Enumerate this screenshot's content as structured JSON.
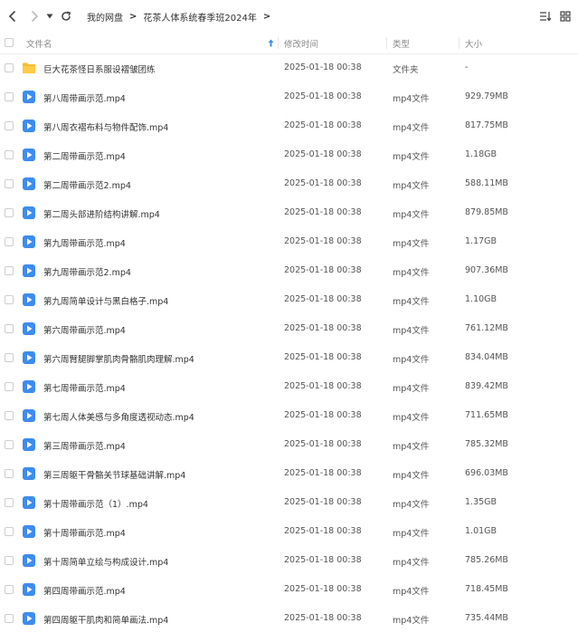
{
  "breadcrumb": [
    "我的网盘",
    "花茶人体系统春季班2024年"
  ],
  "columns": {
    "name": "文件名",
    "time": "修改时间",
    "type": "类型",
    "size": "大小"
  },
  "colors": {
    "folder": "#f5bd2f",
    "video": "#3d8cf0"
  },
  "files": [
    {
      "icon": "folder-icon",
      "name": "巨大花茶怪日系服设褶皱团练",
      "time": "2025-01-18 00:38",
      "type": "文件夹",
      "size": "-"
    },
    {
      "icon": "video-file-icon",
      "name": "第八周带画示范.mp4",
      "time": "2025-01-18 00:38",
      "type": "mp4文件",
      "size": "929.79MB"
    },
    {
      "icon": "video-file-icon",
      "name": "第八周衣褶布料与物件配饰.mp4",
      "time": "2025-01-18 00:38",
      "type": "mp4文件",
      "size": "817.75MB"
    },
    {
      "icon": "video-file-icon",
      "name": "第二周带画示范.mp4",
      "time": "2025-01-18 00:38",
      "type": "mp4文件",
      "size": "1.18GB"
    },
    {
      "icon": "video-file-icon",
      "name": "第二周带画示范2.mp4",
      "time": "2025-01-18 00:38",
      "type": "mp4文件",
      "size": "588.11MB"
    },
    {
      "icon": "video-file-icon",
      "name": "第二周头部进阶结构讲解.mp4",
      "time": "2025-01-18 00:38",
      "type": "mp4文件",
      "size": "879.85MB"
    },
    {
      "icon": "video-file-icon",
      "name": "第九周带画示范.mp4",
      "time": "2025-01-18 00:38",
      "type": "mp4文件",
      "size": "1.17GB"
    },
    {
      "icon": "video-file-icon",
      "name": "第九周带画示范2.mp4",
      "time": "2025-01-18 00:38",
      "type": "mp4文件",
      "size": "907.36MB"
    },
    {
      "icon": "video-file-icon",
      "name": "第九周简单设计与黑白格子.mp4",
      "time": "2025-01-18 00:38",
      "type": "mp4文件",
      "size": "1.10GB"
    },
    {
      "icon": "video-file-icon",
      "name": "第六周带画示范.mp4",
      "time": "2025-01-18 00:38",
      "type": "mp4文件",
      "size": "761.12MB"
    },
    {
      "icon": "video-file-icon",
      "name": "第六周臂腿脚掌肌肉骨骼肌肉理解.mp4",
      "time": "2025-01-18 00:38",
      "type": "mp4文件",
      "size": "834.04MB"
    },
    {
      "icon": "video-file-icon",
      "name": "第七周带画示范.mp4",
      "time": "2025-01-18 00:38",
      "type": "mp4文件",
      "size": "839.42MB"
    },
    {
      "icon": "video-file-icon",
      "name": "第七周人体美感与多角度透视动态.mp4",
      "time": "2025-01-18 00:38",
      "type": "mp4文件",
      "size": "711.65MB"
    },
    {
      "icon": "video-file-icon",
      "name": "第三周带画示范.mp4",
      "time": "2025-01-18 00:38",
      "type": "mp4文件",
      "size": "785.32MB"
    },
    {
      "icon": "video-file-icon",
      "name": "第三周躯干骨骼关节球基础讲解.mp4",
      "time": "2025-01-18 00:38",
      "type": "mp4文件",
      "size": "696.03MB"
    },
    {
      "icon": "video-file-icon",
      "name": "第十周带画示范（1）.mp4",
      "time": "2025-01-18 00:38",
      "type": "mp4文件",
      "size": "1.35GB"
    },
    {
      "icon": "video-file-icon",
      "name": "第十周带画示范.mp4",
      "time": "2025-01-18 00:38",
      "type": "mp4文件",
      "size": "1.01GB"
    },
    {
      "icon": "video-file-icon",
      "name": "第十周简单立绘与构成设计.mp4",
      "time": "2025-01-18 00:38",
      "type": "mp4文件",
      "size": "785.26MB"
    },
    {
      "icon": "video-file-icon",
      "name": "第四周带画示范.mp4",
      "time": "2025-01-18 00:38",
      "type": "mp4文件",
      "size": "718.45MB"
    },
    {
      "icon": "video-file-icon",
      "name": "第四周躯干肌肉和简单画法.mp4",
      "time": "2025-01-18 00:38",
      "type": "mp4文件",
      "size": "735.44MB"
    }
  ]
}
